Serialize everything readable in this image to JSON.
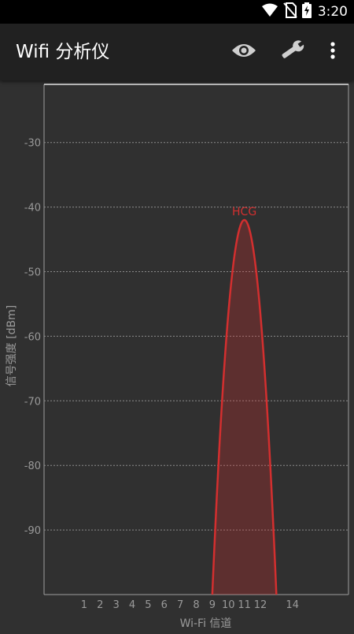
{
  "status_bar": {
    "time": "3:20"
  },
  "app_bar": {
    "title": "Wifi 分析仪",
    "actions": [
      "eye-icon",
      "wrench-icon",
      "overflow-menu-icon"
    ]
  },
  "colors": {
    "signal": "#d32f2f",
    "background": "#303030",
    "app_bar": "#212121",
    "gridline": "#8a8a8a",
    "axis_text": "#9a9a9a"
  },
  "chart_data": {
    "type": "area",
    "ylabel": "信号强度 [dBm]",
    "xlabel": "Wi-Fi 信道",
    "x_ticks": [
      1,
      2,
      3,
      4,
      5,
      6,
      7,
      8,
      9,
      10,
      11,
      12,
      14
    ],
    "y_ticks": [
      -30,
      -40,
      -50,
      -60,
      -70,
      -80,
      -90
    ],
    "ylim": [
      -100,
      -21
    ],
    "xlim": [
      -1.5,
      17.5
    ],
    "grid": true,
    "series": [
      {
        "name": "HCG",
        "channel": 11,
        "rssi": -42,
        "span": [
          9,
          13
        ]
      }
    ]
  }
}
